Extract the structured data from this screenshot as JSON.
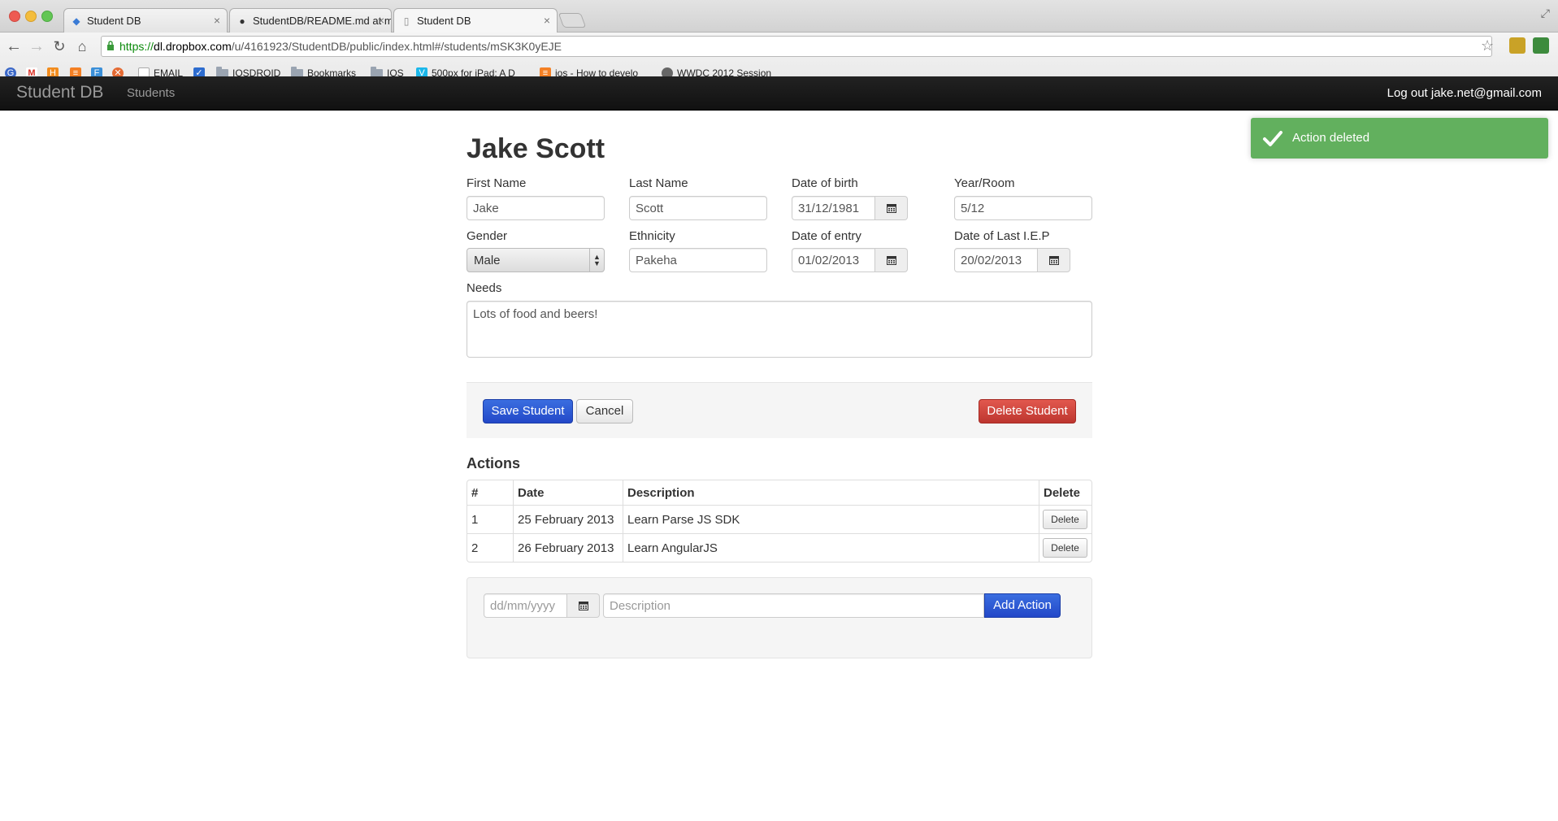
{
  "browser": {
    "tabs": [
      {
        "title": "Student DB",
        "icon": "angular-icon"
      },
      {
        "title": "StudentDB/README.md at m",
        "icon": "github-icon"
      },
      {
        "title": "Student DB",
        "icon": "page-icon",
        "active": true
      }
    ],
    "url": {
      "scheme": "https://",
      "host": "dl.dropbox.com",
      "path": "/u/4161923/StudentDB/public/index.html#/students/mSK3K0yEJE"
    },
    "bookmarks": [
      {
        "label": "EMAIL",
        "icon": "page-icon"
      },
      {
        "label": "IOSDROID",
        "icon": "folder-icon"
      },
      {
        "label": "Bookmarks",
        "icon": "folder-icon"
      },
      {
        "label": "IOS",
        "icon": "folder-icon"
      },
      {
        "label": "500px for iPad: A D",
        "icon": "vimeo-icon"
      },
      {
        "label": "ios - How to develo",
        "icon": "stackoverflow-icon"
      },
      {
        "label": "WWDC 2012 Session",
        "icon": "apple-icon"
      }
    ]
  },
  "navbar": {
    "brand": "Student DB",
    "students_link": "Students",
    "logout_link": "Log out jake.net@gmail.com"
  },
  "toast": {
    "message": "Action deleted",
    "color": "#62b05e"
  },
  "student": {
    "heading": "Jake Scott",
    "fields": {
      "first_name": {
        "label": "First Name",
        "value": "Jake"
      },
      "last_name": {
        "label": "Last Name",
        "value": "Scott"
      },
      "dob": {
        "label": "Date of birth",
        "value": "31/12/1981"
      },
      "year_room": {
        "label": "Year/Room",
        "value": "5/12"
      },
      "gender": {
        "label": "Gender",
        "value": "Male"
      },
      "ethnicity": {
        "label": "Ethnicity",
        "value": "Pakeha"
      },
      "date_of_entry": {
        "label": "Date of entry",
        "value": "01/02/2013"
      },
      "date_last_iep": {
        "label": "Date of Last I.E.P",
        "value": "20/02/2013"
      },
      "needs": {
        "label": "Needs",
        "value": "Lots of food and beers!"
      }
    },
    "buttons": {
      "save": "Save Student",
      "cancel": "Cancel",
      "delete": "Delete Student"
    }
  },
  "actions": {
    "title": "Actions",
    "columns": [
      "#",
      "Date",
      "Description",
      "Delete"
    ],
    "rows": [
      {
        "num": "1",
        "date": "25 February 2013",
        "description": "Learn Parse JS SDK",
        "delete_label": "Delete"
      },
      {
        "num": "2",
        "date": "26 February 2013",
        "description": "Learn AngularJS",
        "delete_label": "Delete"
      }
    ],
    "new_action": {
      "date_placeholder": "dd/mm/yyyy",
      "description_placeholder": "Description",
      "add_label": "Add Action"
    }
  }
}
